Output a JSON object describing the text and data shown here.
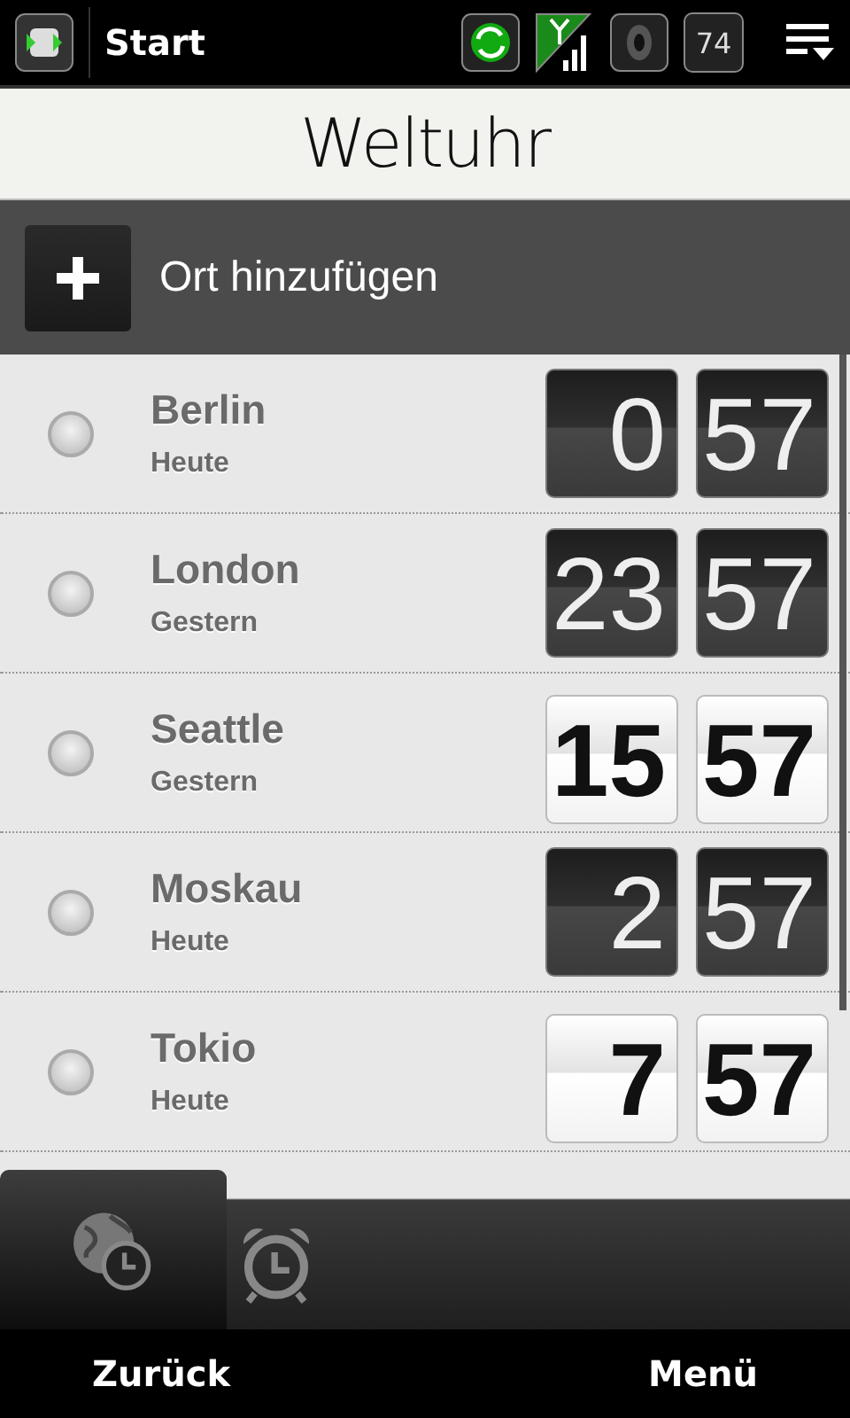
{
  "status_bar": {
    "title": "Start",
    "battery": "74"
  },
  "header": {
    "title": "Weltuhr"
  },
  "add_button": {
    "label": "Ort hinzufügen"
  },
  "cities": [
    {
      "name": "Berlin",
      "day": "Heute",
      "hour": "0",
      "minute": "57",
      "daytime": false,
      "selected": false
    },
    {
      "name": "London",
      "day": "Gestern",
      "hour": "23",
      "minute": "57",
      "daytime": false,
      "selected": false
    },
    {
      "name": "Seattle",
      "day": "Gestern",
      "hour": "15",
      "minute": "57",
      "daytime": true,
      "selected": false
    },
    {
      "name": "Moskau",
      "day": "Heute",
      "hour": "2",
      "minute": "57",
      "daytime": false,
      "selected": false
    },
    {
      "name": "Tokio",
      "day": "Heute",
      "hour": "7",
      "minute": "57",
      "daytime": true,
      "selected": false
    }
  ],
  "tabs": [
    {
      "kind": "worldclock",
      "selected": true
    },
    {
      "kind": "alarm",
      "selected": false
    }
  ],
  "softkeys": [
    "Zurück",
    "Menü"
  ]
}
